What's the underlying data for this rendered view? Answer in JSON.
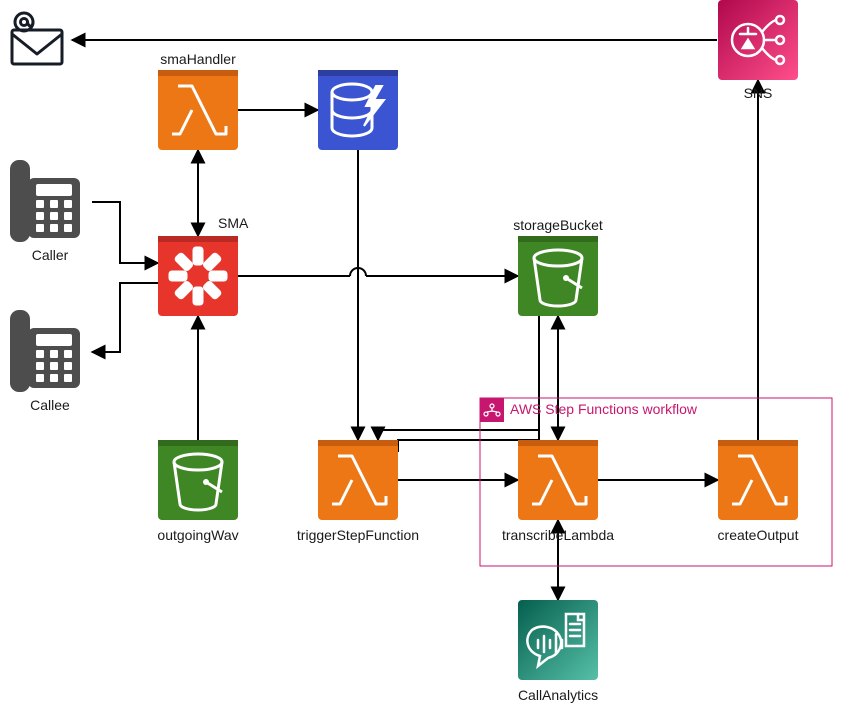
{
  "diagram": {
    "nodes": {
      "email": {
        "label": ""
      },
      "caller": {
        "label": "Caller"
      },
      "callee": {
        "label": "Callee"
      },
      "sma": {
        "label": "SMA"
      },
      "smaHandler": {
        "label": "smaHandler"
      },
      "dynamo": {
        "label": ""
      },
      "outgoingWav": {
        "label": "outgoingWav"
      },
      "storageBucket": {
        "label": "storageBucket"
      },
      "triggerStep": {
        "label": "triggerStepFunction"
      },
      "transcribe": {
        "label": "transcribeLambda"
      },
      "createOutput": {
        "label": "createOutput"
      },
      "callAnalytics": {
        "label": "CallAnalytics"
      },
      "sns": {
        "label": "SNS"
      }
    },
    "group": {
      "stepFunctions": {
        "label": "AWS Step Functions workflow"
      }
    },
    "colors": {
      "lambda": "#ed7615",
      "lambdaDark": "#c85d0f",
      "s3": "#3f8624",
      "s3Dark": "#326b1c",
      "chime": "#e7352c",
      "chimeDark": "#b82a23",
      "dynamo": "#3b54d1",
      "dynamoDark": "#2c3fa0",
      "sns1": "#b0084d",
      "sns2": "#ff4f8b",
      "transcribe1": "#055f4e",
      "transcribe2": "#56c0a7",
      "stepBorder": "#c7166f",
      "phone": "#4d4d4d",
      "ink": "#161d27"
    },
    "edges": [
      {
        "from": "caller",
        "to": "sma",
        "bidir": false
      },
      {
        "from": "sma",
        "to": "callee",
        "bidir": false
      },
      {
        "from": "sma",
        "to": "smaHandler",
        "bidir": true
      },
      {
        "from": "smaHandler",
        "to": "dynamo",
        "bidir": false
      },
      {
        "from": "outgoingWav",
        "to": "sma",
        "bidir": false
      },
      {
        "from": "sma",
        "to": "storageBucket",
        "bidir": false
      },
      {
        "from": "dynamo",
        "to": "triggerStep",
        "bidir": false
      },
      {
        "from": "storageBucket",
        "to": "triggerStep",
        "bidir": false
      },
      {
        "from": "triggerStep",
        "to": "transcribe",
        "bidir": false
      },
      {
        "from": "transcribe",
        "to": "storageBucket",
        "bidir": true
      },
      {
        "from": "transcribe",
        "to": "callAnalytics",
        "bidir": true
      },
      {
        "from": "transcribe",
        "to": "createOutput",
        "bidir": false
      },
      {
        "from": "createOutput",
        "to": "sns",
        "bidir": false
      },
      {
        "from": "sns",
        "to": "email",
        "bidir": false
      }
    ]
  }
}
